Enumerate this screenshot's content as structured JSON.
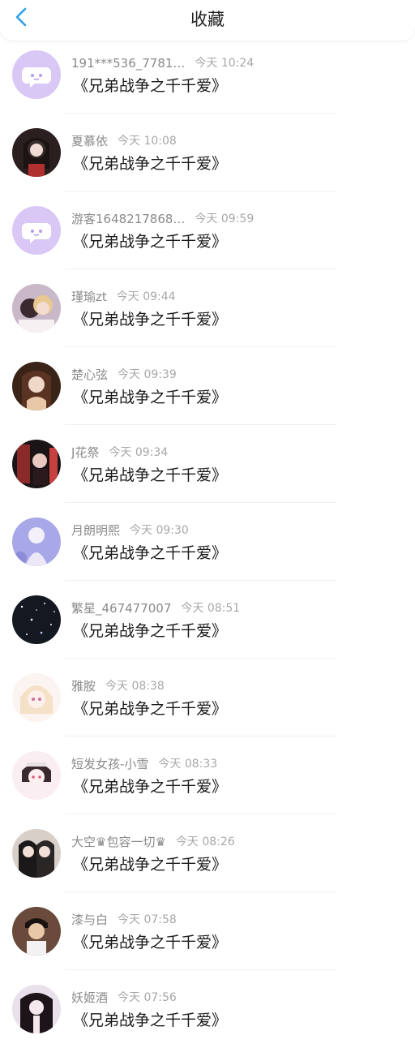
{
  "header": {
    "title": "收藏",
    "back_icon": "chevron-left-icon",
    "accent_color": "#2aa3e8"
  },
  "items": [
    {
      "user": "191***536_7781…",
      "time": "今天 10:24",
      "book": "《兄弟战争之千千爱》",
      "avatar": "default-chat-avatar"
    },
    {
      "user": "夏慕依",
      "time": "今天 10:08",
      "book": "《兄弟战争之千千爱》",
      "avatar": "photo-avatar"
    },
    {
      "user": "游客1648217868…",
      "time": "今天 09:59",
      "book": "《兄弟战争之千千爱》",
      "avatar": "default-chat-avatar"
    },
    {
      "user": "瑾瑜zt",
      "time": "今天 09:44",
      "book": "《兄弟战争之千千爱》",
      "avatar": "photo-avatar"
    },
    {
      "user": "楚心弦",
      "time": "今天 09:39",
      "book": "《兄弟战争之千千爱》",
      "avatar": "photo-avatar"
    },
    {
      "user": "J花祭",
      "time": "今天 09:34",
      "book": "《兄弟战争之千千爱》",
      "avatar": "photo-avatar"
    },
    {
      "user": "月朗明熙",
      "time": "今天 09:30",
      "book": "《兄弟战争之千千爱》",
      "avatar": "photo-avatar"
    },
    {
      "user": "繁星_467477007",
      "time": "今天 08:51",
      "book": "《兄弟战争之千千爱》",
      "avatar": "photo-avatar"
    },
    {
      "user": "雅胺",
      "time": "今天 08:38",
      "book": "《兄弟战争之千千爱》",
      "avatar": "photo-avatar"
    },
    {
      "user": "短发女孩-小雪",
      "time": "今天 08:33",
      "book": "《兄弟战争之千千爱》",
      "avatar": "photo-avatar"
    },
    {
      "user": "大空♛包容一切♛",
      "time": "今天 08:26",
      "book": "《兄弟战争之千千爱》",
      "avatar": "photo-avatar"
    },
    {
      "user": "漆与白",
      "time": "今天 07:58",
      "book": "《兄弟战争之千千爱》",
      "avatar": "photo-avatar"
    },
    {
      "user": "妖姬酒",
      "time": "今天 07:56",
      "book": "《兄弟战争之千千爱》",
      "avatar": "photo-avatar"
    }
  ]
}
